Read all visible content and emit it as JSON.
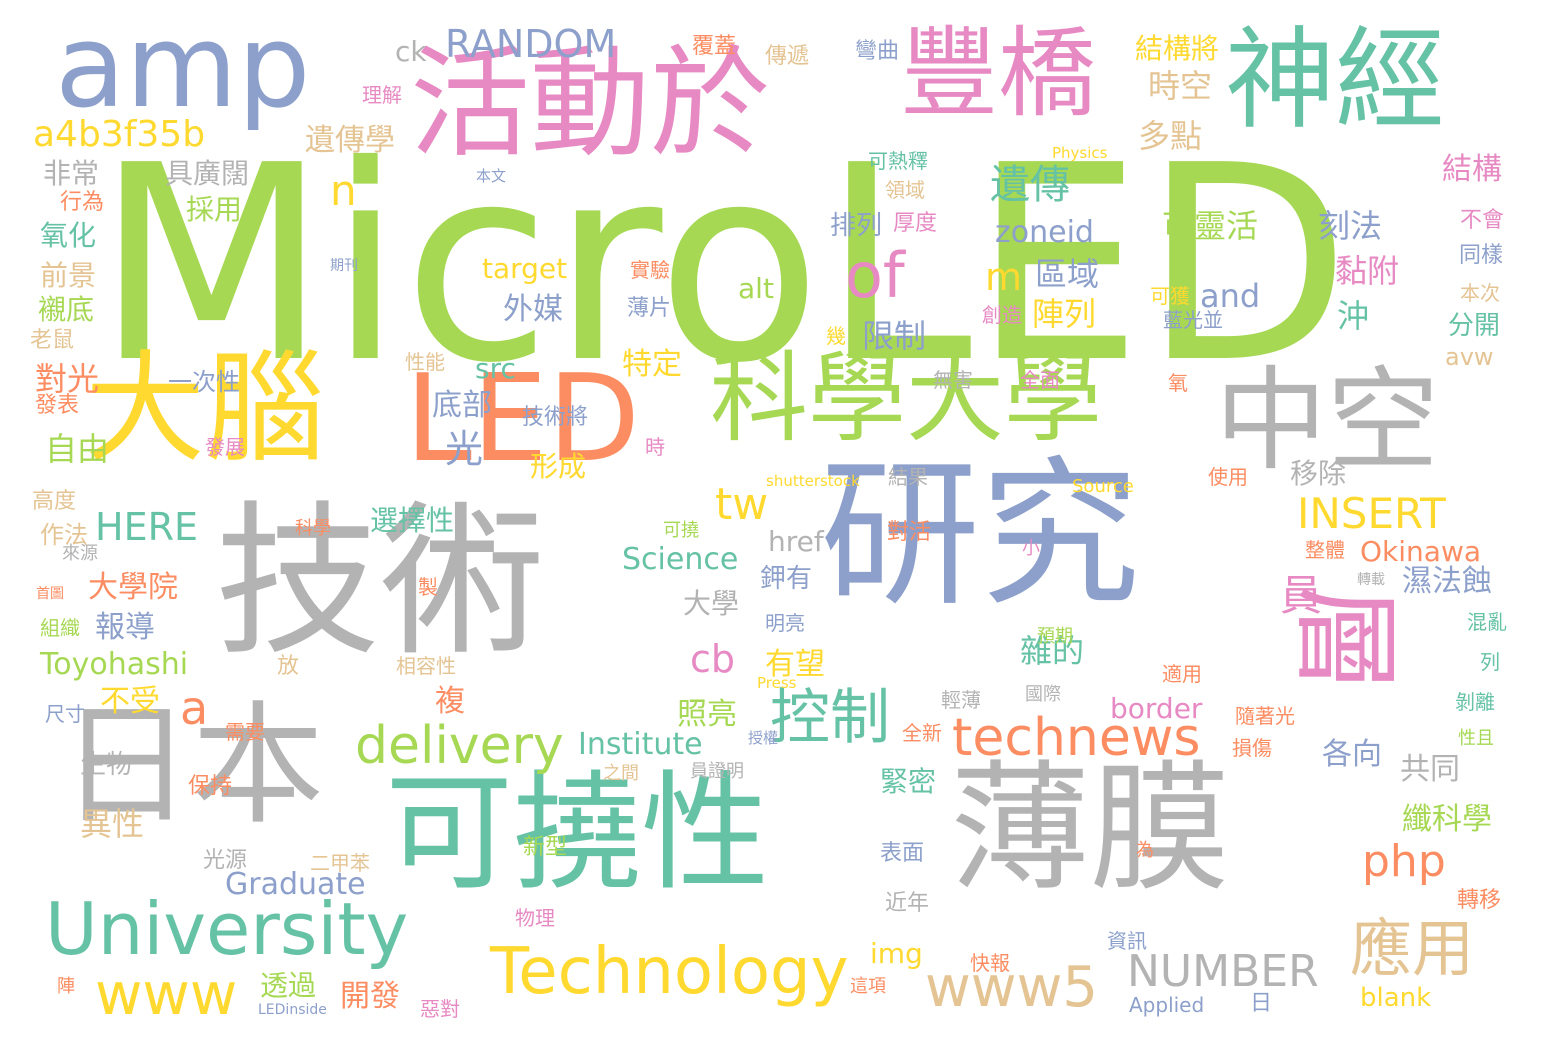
{
  "palette": {
    "green": "#a6d854",
    "teal": "#66c2a5",
    "blue": "#8da0cb",
    "pink": "#e78ac3",
    "orange": "#fc8d62",
    "yellow": "#ffd92f",
    "tan": "#e5c494",
    "gray": "#b3b3b3"
  },
  "words": [
    {
      "text": "MicroLED",
      "color": "green"
    },
    {
      "text": "技術",
      "color": "gray"
    },
    {
      "text": "研究",
      "color": "blue"
    },
    {
      "text": "可撓性",
      "color": "teal"
    },
    {
      "text": "薄膜",
      "color": "gray"
    },
    {
      "text": "日本",
      "color": "gray"
    },
    {
      "text": "活動於",
      "color": "pink"
    },
    {
      "text": "豐橋",
      "color": "pink"
    },
    {
      "text": "神經",
      "color": "teal"
    },
    {
      "text": "amp",
      "color": "blue"
    },
    {
      "text": "大腦",
      "color": "yellow"
    },
    {
      "text": "LED",
      "color": "orange"
    },
    {
      "text": "科學大學",
      "color": "green"
    },
    {
      "text": "中空",
      "color": "gray"
    },
    {
      "text": "層",
      "color": "pink"
    },
    {
      "text": "University",
      "color": "teal"
    },
    {
      "text": "Technology",
      "color": "yellow"
    },
    {
      "text": "technews",
      "color": "orange"
    },
    {
      "text": "delivery",
      "color": "green"
    },
    {
      "text": "www5",
      "color": "tan"
    },
    {
      "text": "www",
      "color": "yellow"
    },
    {
      "text": "控制",
      "color": "teal"
    },
    {
      "text": "應用",
      "color": "tan"
    },
    {
      "text": "of",
      "color": "pink"
    },
    {
      "text": "RANDOM",
      "color": "blue"
    },
    {
      "text": "a4b3f35b",
      "color": "yellow"
    },
    {
      "text": "tw",
      "color": "yellow"
    },
    {
      "text": "php",
      "color": "orange"
    },
    {
      "text": "INSERT",
      "color": "yellow"
    },
    {
      "text": "HERE",
      "color": "teal"
    },
    {
      "text": "NUMBER",
      "color": "gray"
    },
    {
      "text": "cb",
      "color": "pink"
    },
    {
      "text": "Science",
      "color": "teal"
    },
    {
      "text": "Institute",
      "color": "teal"
    },
    {
      "text": "Graduate",
      "color": "blue"
    },
    {
      "text": "Toyohashi",
      "color": "green"
    },
    {
      "text": "Okinawa",
      "color": "orange"
    },
    {
      "text": "遺傳",
      "color": "teal"
    },
    {
      "text": "n",
      "color": "yellow"
    },
    {
      "text": "a",
      "color": "orange"
    },
    {
      "text": "zoneid",
      "color": "blue"
    },
    {
      "text": "m",
      "color": "yellow"
    },
    {
      "text": "ck",
      "color": "gray"
    },
    {
      "text": "光",
      "color": "blue"
    },
    {
      "text": "員",
      "color": "pink"
    },
    {
      "text": "target",
      "color": "yellow"
    },
    {
      "text": "alt",
      "color": "green"
    },
    {
      "text": "and",
      "color": "blue"
    },
    {
      "text": "src",
      "color": "teal"
    },
    {
      "text": "href",
      "color": "gray"
    },
    {
      "text": "border",
      "color": "pink"
    },
    {
      "text": "img",
      "color": "yellow"
    },
    {
      "text": "blank",
      "color": "yellow"
    },
    {
      "text": "avw",
      "color": "tan"
    },
    {
      "text": "遺傳學",
      "color": "tan"
    },
    {
      "text": "時空",
      "color": "tan"
    },
    {
      "text": "多點",
      "color": "tan"
    },
    {
      "text": "結構將",
      "color": "yellow"
    },
    {
      "text": "結構",
      "color": "pink"
    },
    {
      "text": "具廣闊",
      "color": "gray"
    },
    {
      "text": "非常",
      "color": "gray"
    },
    {
      "text": "採用",
      "color": "green"
    },
    {
      "text": "氧化",
      "color": "teal"
    },
    {
      "text": "前景",
      "color": "tan"
    },
    {
      "text": "襯底",
      "color": "green"
    },
    {
      "text": "老鼠",
      "color": "tan"
    },
    {
      "text": "行為",
      "color": "orange"
    },
    {
      "text": "對光",
      "color": "orange"
    },
    {
      "text": "發表",
      "color": "orange"
    },
    {
      "text": "自由",
      "color": "green"
    },
    {
      "text": "高度",
      "color": "tan"
    },
    {
      "text": "作法",
      "color": "tan"
    },
    {
      "text": "外媒",
      "color": "blue"
    },
    {
      "text": "特定",
      "color": "yellow"
    },
    {
      "text": "底部",
      "color": "blue"
    },
    {
      "text": "形成",
      "color": "yellow"
    },
    {
      "text": "技術將",
      "color": "blue"
    },
    {
      "text": "一次性",
      "color": "blue"
    },
    {
      "text": "區域",
      "color": "blue"
    },
    {
      "text": "陣列",
      "color": "yellow"
    },
    {
      "text": "限制",
      "color": "blue"
    },
    {
      "text": "排列",
      "color": "blue"
    },
    {
      "text": "厚度",
      "color": "pink"
    },
    {
      "text": "可靈活",
      "color": "green"
    },
    {
      "text": "刻法",
      "color": "blue"
    },
    {
      "text": "黏附",
      "color": "pink"
    },
    {
      "text": "沖",
      "color": "teal"
    },
    {
      "text": "分開",
      "color": "teal"
    },
    {
      "text": "移除",
      "color": "gray"
    },
    {
      "text": "選擇性",
      "color": "teal"
    },
    {
      "text": "大學院",
      "color": "orange"
    },
    {
      "text": "報導",
      "color": "blue"
    },
    {
      "text": "大學",
      "color": "gray"
    },
    {
      "text": "鉀有",
      "color": "blue"
    },
    {
      "text": "有望",
      "color": "yellow"
    },
    {
      "text": "照亮",
      "color": "green"
    },
    {
      "text": "不受",
      "color": "yellow"
    },
    {
      "text": "複",
      "color": "orange"
    },
    {
      "text": "雜的",
      "color": "teal"
    },
    {
      "text": "濕法蝕",
      "color": "blue"
    },
    {
      "text": "各向",
      "color": "blue"
    },
    {
      "text": "共同",
      "color": "gray"
    },
    {
      "text": "緊密",
      "color": "teal"
    },
    {
      "text": "異性",
      "color": "tan"
    },
    {
      "text": "生物",
      "color": "gray"
    },
    {
      "text": "纖科學",
      "color": "green"
    },
    {
      "text": "保持",
      "color": "orange"
    },
    {
      "text": "透過",
      "color": "green"
    },
    {
      "text": "開發",
      "color": "orange"
    },
    {
      "text": "光源",
      "color": "gray"
    },
    {
      "text": "新型",
      "color": "green"
    },
    {
      "text": "物理",
      "color": "pink"
    },
    {
      "text": "近年",
      "color": "gray"
    },
    {
      "text": "表面",
      "color": "blue"
    },
    {
      "text": "快報",
      "color": "orange"
    },
    {
      "text": "資訊",
      "color": "blue"
    },
    {
      "text": "轉移",
      "color": "orange"
    },
    {
      "text": "Applied",
      "color": "blue"
    },
    {
      "text": "日",
      "color": "blue"
    },
    {
      "text": "Source",
      "color": "yellow"
    },
    {
      "text": "shutterstock",
      "color": "yellow"
    },
    {
      "text": "Physics",
      "color": "yellow"
    },
    {
      "text": "Press",
      "color": "yellow"
    },
    {
      "text": "LEDinside",
      "color": "blue"
    },
    {
      "text": "本文",
      "color": "blue"
    },
    {
      "text": "期刊",
      "color": "blue"
    },
    {
      "text": "理解",
      "color": "pink"
    },
    {
      "text": "傳遞",
      "color": "tan"
    },
    {
      "text": "覆蓋",
      "color": "orange"
    },
    {
      "text": "彎曲",
      "color": "blue"
    },
    {
      "text": "可熱釋",
      "color": "teal"
    },
    {
      "text": "領域",
      "color": "tan"
    },
    {
      "text": "實驗",
      "color": "orange"
    },
    {
      "text": "薄片",
      "color": "blue"
    },
    {
      "text": "創造",
      "color": "pink"
    },
    {
      "text": "幾",
      "color": "yellow"
    },
    {
      "text": "可獲",
      "color": "yellow"
    },
    {
      "text": "藍光並",
      "color": "blue"
    },
    {
      "text": "不會",
      "color": "pink"
    },
    {
      "text": "同樣",
      "color": "blue"
    },
    {
      "text": "本次",
      "color": "tan"
    },
    {
      "text": "性能",
      "color": "tan"
    },
    {
      "text": "無害",
      "color": "gray"
    },
    {
      "text": "全面",
      "color": "pink"
    },
    {
      "text": "氧",
      "color": "orange"
    },
    {
      "text": "時",
      "color": "pink"
    },
    {
      "text": "結果",
      "color": "gray"
    },
    {
      "text": "發展",
      "color": "pink"
    },
    {
      "text": "使用",
      "color": "orange"
    },
    {
      "text": "科學",
      "color": "orange"
    },
    {
      "text": "對活",
      "color": "orange"
    },
    {
      "text": "可撓",
      "color": "green"
    },
    {
      "text": "小",
      "color": "pink"
    },
    {
      "text": "整體",
      "color": "orange"
    },
    {
      "text": "轉載",
      "color": "gray"
    },
    {
      "text": "混亂",
      "color": "teal"
    },
    {
      "text": "列",
      "color": "teal"
    },
    {
      "text": "剝離",
      "color": "teal"
    },
    {
      "text": "性且",
      "color": "green"
    },
    {
      "text": "製",
      "color": "orange"
    },
    {
      "text": "預期",
      "color": "green"
    },
    {
      "text": "明亮",
      "color": "blue"
    },
    {
      "text": "適用",
      "color": "orange"
    },
    {
      "text": "隨著光",
      "color": "orange"
    },
    {
      "text": "國際",
      "color": "gray"
    },
    {
      "text": "損傷",
      "color": "orange"
    },
    {
      "text": "輕薄",
      "color": "gray"
    },
    {
      "text": "全新",
      "color": "orange"
    },
    {
      "text": "授權",
      "color": "blue"
    },
    {
      "text": "員證明",
      "color": "gray"
    },
    {
      "text": "之間",
      "color": "tan"
    },
    {
      "text": "需要",
      "color": "orange"
    },
    {
      "text": "相容性",
      "color": "tan"
    },
    {
      "text": "放",
      "color": "tan"
    },
    {
      "text": "二甲苯",
      "color": "tan"
    },
    {
      "text": "為",
      "color": "orange"
    },
    {
      "text": "這項",
      "color": "orange"
    },
    {
      "text": "惡對",
      "color": "pink"
    },
    {
      "text": "陣",
      "color": "orange"
    },
    {
      "text": "首圖",
      "color": "orange"
    },
    {
      "text": "來源",
      "color": "gray"
    },
    {
      "text": "組織",
      "color": "green"
    },
    {
      "text": "尺寸",
      "color": "blue"
    }
  ]
}
